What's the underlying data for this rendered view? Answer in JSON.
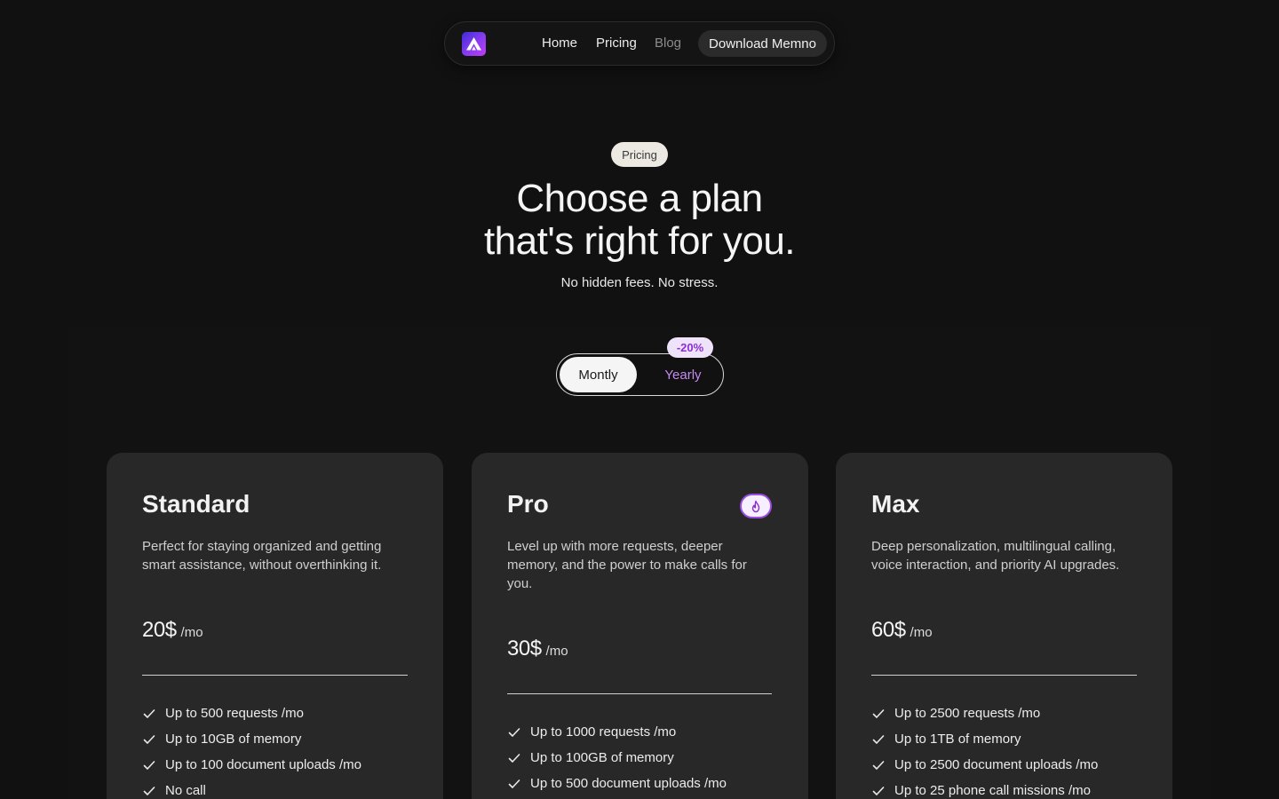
{
  "nav": {
    "logo_icon": "memno-logo-icon",
    "links": [
      "Home",
      "Pricing",
      "Blog"
    ],
    "cta": "Download Memno"
  },
  "hero": {
    "pill": "Pricing",
    "headline_line1": "Choose a plan",
    "headline_line2": "that's right for you.",
    "subline": "No hidden fees. No stress."
  },
  "billing": {
    "monthly": "Montly",
    "yearly": "Yearly",
    "discount": "-20%",
    "selected": "Montly"
  },
  "plans": [
    {
      "name": "Standard",
      "description": "Perfect for staying organized and getting smart assistance, without overthinking it.",
      "price": "20$",
      "per": "/mo",
      "features": [
        "Up to 500 requests /mo",
        "Up to 10GB of memory",
        "Up to 100 document uploads /mo",
        "No call"
      ]
    },
    {
      "name": "Pro",
      "badge_icon": "flame-icon",
      "description": "Level up with more requests, deeper memory, and the power to make calls for you.",
      "price": "30$",
      "per": "/mo",
      "features": [
        "Up to 1000 requests /mo",
        "Up to 100GB of memory",
        "Up to 500 document uploads /mo"
      ]
    },
    {
      "name": "Max",
      "description": "Deep personalization, multilingual calling, voice interaction, and priority AI upgrades.",
      "price": "60$",
      "per": "/mo",
      "features": [
        "Up to 2500 requests /mo",
        "Up to 1TB of memory",
        "Up to 2500 document uploads /mo",
        "Up to 25 phone call missions /mo"
      ]
    }
  ],
  "colors": {
    "background": "#111111",
    "card": "#282828",
    "accent": "#8b2fd4",
    "yearly_text": "#c58af0"
  }
}
